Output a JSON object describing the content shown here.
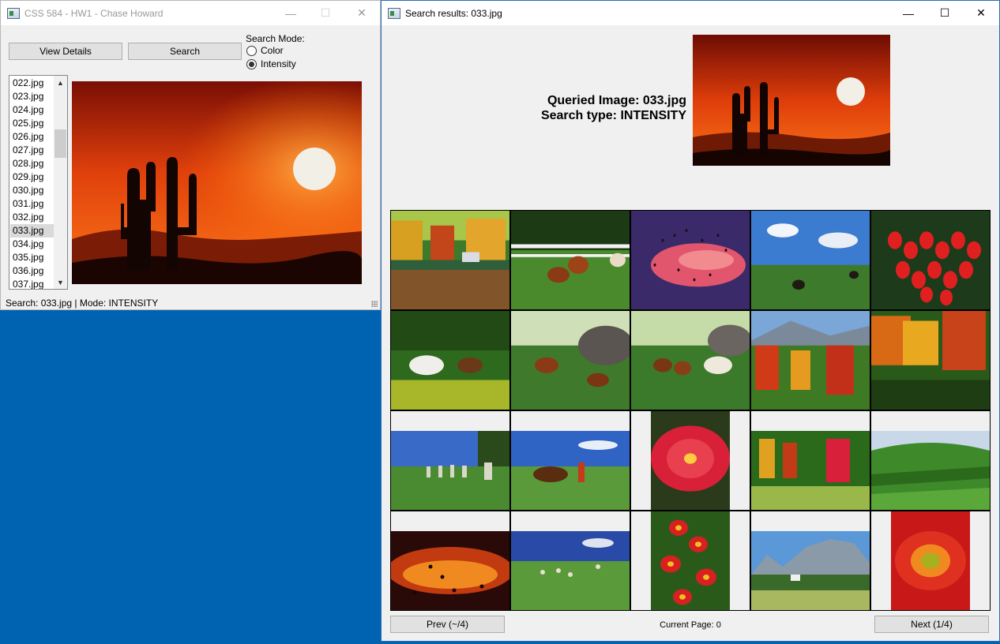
{
  "main_window": {
    "title": "CSS 584 - HW1 - Chase Howard",
    "view_details_label": "View Details",
    "search_label": "Search",
    "search_mode_label": "Search Mode:",
    "mode_color_label": "Color",
    "mode_intensity_label": "Intensity",
    "selected_mode": "Intensity",
    "file_list": [
      "022.jpg",
      "023.jpg",
      "024.jpg",
      "025.jpg",
      "026.jpg",
      "027.jpg",
      "028.jpg",
      "029.jpg",
      "030.jpg",
      "031.jpg",
      "032.jpg",
      "033.jpg",
      "034.jpg",
      "035.jpg",
      "036.jpg",
      "037.jpg"
    ],
    "selected_file": "033.jpg",
    "status": "Search: 033.jpg | Mode: INTENSITY"
  },
  "results_window": {
    "title": "Search results: 033.jpg",
    "queried_image_label": "Queried Image: 033.jpg",
    "search_type_label": "Search type: INTENSITY",
    "prev_label": "Prev (~/4)",
    "next_label": "Next (1/4)",
    "current_page_label": "Current Page: 0",
    "results": [
      {
        "scene": "autumn-lake"
      },
      {
        "scene": "horses-fence"
      },
      {
        "scene": "bird-flock-sunset"
      },
      {
        "scene": "riders-meadow"
      },
      {
        "scene": "red-berries"
      },
      {
        "scene": "white-horse-foal"
      },
      {
        "scene": "horses-rocks"
      },
      {
        "scene": "horses-barn"
      },
      {
        "scene": "autumn-forest-mountain"
      },
      {
        "scene": "autumn-forest"
      },
      {
        "scene": "gravestones-field"
      },
      {
        "scene": "cowboy-horse"
      },
      {
        "scene": "red-hibiscus"
      },
      {
        "scene": "autumn-treeline"
      },
      {
        "scene": "green-hills"
      },
      {
        "scene": "birds-orange-sky"
      },
      {
        "scene": "horses-pasture"
      },
      {
        "scene": "red-primroses"
      },
      {
        "scene": "mountain-village"
      },
      {
        "scene": "red-gerbera"
      }
    ]
  }
}
